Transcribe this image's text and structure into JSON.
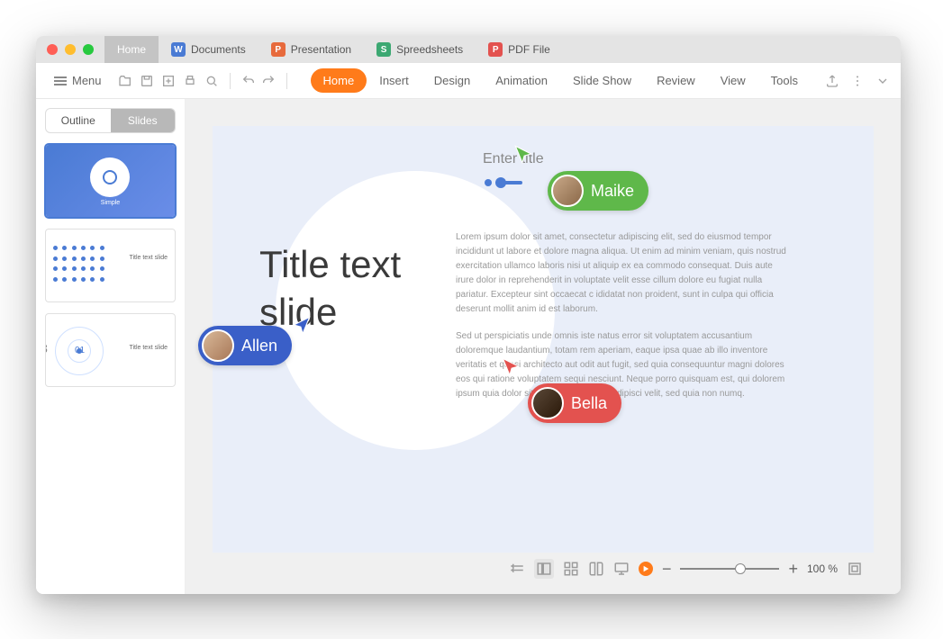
{
  "tabs": {
    "home": "Home",
    "documents": "Documents",
    "presentation": "Presentation",
    "spreadsheets": "Spreedsheets",
    "pdf": "PDF File"
  },
  "toolbar": {
    "menu": "Menu"
  },
  "ribbon": {
    "home": "Home",
    "insert": "Insert",
    "design": "Design",
    "animation": "Animation",
    "slideshow": "Slide Show",
    "review": "Review",
    "view": "View",
    "tools": "Tools"
  },
  "sidebar": {
    "outline": "Outline",
    "slides": "Slides",
    "thumbs": [
      {
        "caption": "Simple"
      },
      {
        "caption": "Title text slide"
      },
      {
        "caption": "Title text slide",
        "number": "01",
        "index_prefix": "3"
      }
    ]
  },
  "slide": {
    "enter_title": "Enter title",
    "title": "Title text slide",
    "body1": "Lorem ipsum dolor sit amet, consectetur adipiscing elit, sed do eiusmod tempor incididunt ut labore et dolore magna aliqua. Ut enim ad minim veniam, quis nostrud exercitation ullamco laboris nisi ut aliquip ex ea commodo consequat. Duis aute irure dolor in reprehenderit in voluptate velit esse cillum dolore eu fugiat nulla pariatur. Excepteur sint occaecat c ididatat non proident, sunt in culpa qui officia deserunt mollit anim id est laborum.",
    "body2": "Sed ut perspiciatis unde omnis iste natus error sit voluptatem accusantium doloremque laudantium, totam rem aperiam, eaque ipsa quae ab illo inventore veritatis et quasi architecto aut odit aut fugit, sed quia consequuntur magni dolores eos qui ratione voluptatem sequi nesciunt. Neque porro quisquam est, qui dolorem ipsum quia dolor sit amet, consectetur, adipisci velit, sed quia non numq."
  },
  "collaborators": {
    "maike": "Maike",
    "allen": "Allen",
    "bella": "Bella"
  },
  "status": {
    "zoom": "100 %"
  },
  "colors": {
    "accent": "#ff7b1a",
    "blue": "#3a5fc8",
    "green": "#5fb84a",
    "red": "#e3524f"
  }
}
